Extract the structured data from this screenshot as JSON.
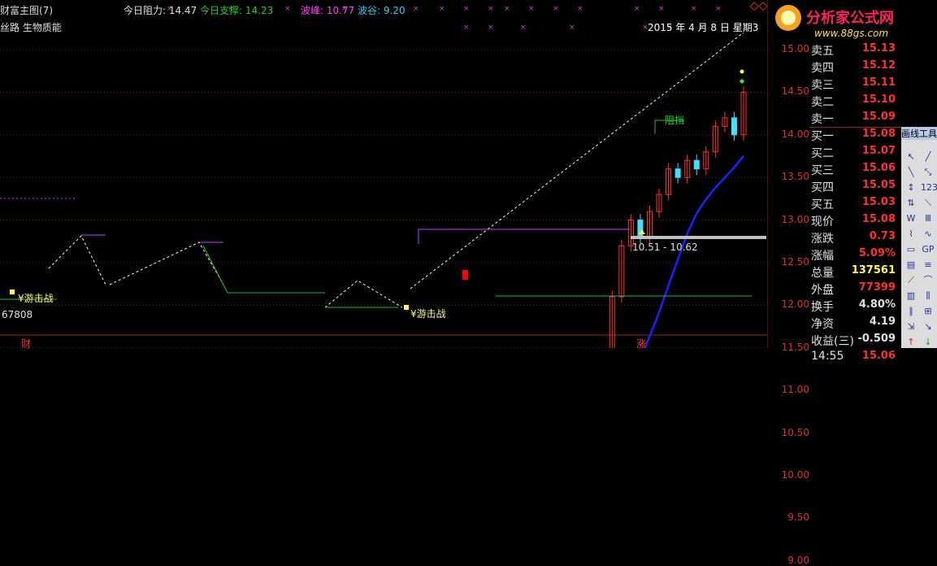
{
  "header": {
    "title": "财富主图(7)",
    "resistance_label": "今日阻力: 14.47",
    "support_label": "今日支撑: 14.23",
    "peak_label": "波峰: 10.77",
    "trough_label": "波谷: 9.20",
    "subtitle": "丝路 生物质能",
    "date_label": "2015 年 4 月 8 日  星期3"
  },
  "chart": {
    "range_label": "10.51 - 10.62",
    "annotation_resist": "阻挡",
    "guerrilla_1": "¥游击战",
    "guerrilla_2": "¥游击战",
    "volume_label": "67808",
    "bottom_left": "财",
    "bottom_mid": "涨"
  },
  "y_axis": [
    "15.00",
    "14.50",
    "14.00",
    "13.50",
    "13.00",
    "12.50",
    "12.00",
    "11.50",
    "11.00",
    "10.50",
    "10.00",
    "9.50",
    "9.00"
  ],
  "logo": {
    "title": "分析家公式网",
    "url": "www.88gs.com"
  },
  "quote": {
    "asks": [
      {
        "label": "卖五",
        "value": "15.13"
      },
      {
        "label": "卖四",
        "value": "15.12"
      },
      {
        "label": "卖三",
        "value": "15.11"
      },
      {
        "label": "卖二",
        "value": "15.10"
      },
      {
        "label": "卖一",
        "value": "15.09"
      }
    ],
    "bids": [
      {
        "label": "买一",
        "value": "15.08"
      },
      {
        "label": "买二",
        "value": "15.07"
      },
      {
        "label": "买三",
        "value": "15.06"
      },
      {
        "label": "买四",
        "value": "15.05"
      },
      {
        "label": "买五",
        "value": "15.03"
      }
    ],
    "stats": [
      {
        "label": "现价",
        "value": "15.08",
        "color": "#ff3030"
      },
      {
        "label": "涨跌",
        "value": "0.73",
        "color": "#ff3030"
      },
      {
        "label": "涨幅",
        "value": "5.09%",
        "color": "#ff3030"
      },
      {
        "label": "总量",
        "value": "137561",
        "color": "#ffff40"
      },
      {
        "label": "外盘",
        "value": "77399",
        "color": "#ff3030"
      }
    ],
    "stats2": [
      {
        "label": "换手",
        "value": "4.80%",
        "color": "#e0e0e0"
      },
      {
        "label": "净资",
        "value": "4.19",
        "color": "#e0e0e0"
      },
      {
        "label": "收益(三)",
        "value": "-0.509",
        "color": "#e0e0e0"
      }
    ],
    "ticks": [
      {
        "time": "14:55",
        "value": "15.06"
      }
    ]
  },
  "toolbox": {
    "title": "画线工具"
  },
  "colors": {
    "up": "#ff3030",
    "down": "#40e0ff",
    "ma": "#2020ff",
    "trend": "#ffffc0"
  }
}
